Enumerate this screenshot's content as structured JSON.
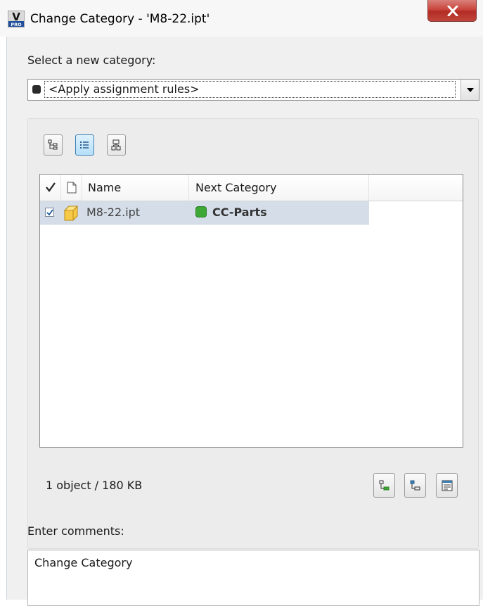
{
  "window": {
    "title": "Change Category - 'M8-22.ipt'",
    "app_icon_letter": "V",
    "app_icon_sub": "PRO",
    "close_label": "X"
  },
  "category": {
    "label": "Select a new category:",
    "selected": "<Apply assignment rules>",
    "swatch_color": "#2b2b2b"
  },
  "view_buttons": [
    {
      "name": "tree-view",
      "icon": "tree-view-icon",
      "active": false
    },
    {
      "name": "list-view",
      "icon": "list-view-icon",
      "active": true
    },
    {
      "name": "structure-view",
      "icon": "structure-view-icon",
      "active": false
    }
  ],
  "grid": {
    "columns": {
      "check": "check-column-icon",
      "type": "document-column-icon",
      "name": "Name",
      "next_category": "Next Category"
    },
    "rows": [
      {
        "checked": true,
        "icon": "part-cube-icon",
        "name": "M8-22.ipt",
        "next_category": "CC-Parts",
        "category_color": "#3ea836"
      }
    ]
  },
  "summary": "1 object / 180 KB",
  "action_buttons": [
    "include-children-icon",
    "include-parents-icon",
    "settings-list-icon"
  ],
  "comments": {
    "label": "Enter comments:",
    "value": "Change Category"
  },
  "colors": {
    "selected_row": "#d4dde8",
    "active_button": "#b5dff9",
    "close_button": "#c9453d"
  }
}
